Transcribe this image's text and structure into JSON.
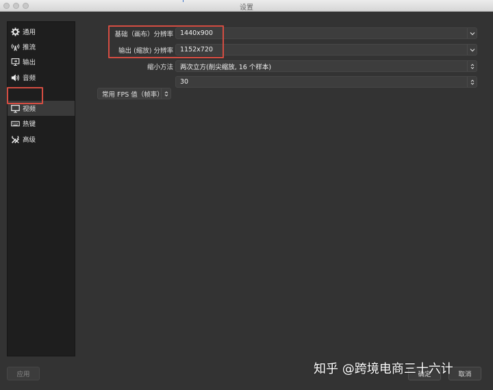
{
  "window": {
    "title": "设置"
  },
  "sidebar": {
    "items": [
      {
        "label": "通用",
        "icon": "gear-icon"
      },
      {
        "label": "推流",
        "icon": "broadcast-icon"
      },
      {
        "label": "输出",
        "icon": "output-icon"
      },
      {
        "label": "音频",
        "icon": "speaker-icon"
      },
      {
        "label": "视频",
        "icon": "monitor-icon",
        "active": true
      },
      {
        "label": "热键",
        "icon": "keyboard-icon"
      },
      {
        "label": "高级",
        "icon": "tools-icon"
      }
    ]
  },
  "video": {
    "base_resolution": {
      "label": "基础（画布）分辨率",
      "value": "1440x900"
    },
    "output_resolution": {
      "label": "输出 (缩放) 分辨率",
      "value": "1152x720"
    },
    "downscale_filter": {
      "label": "缩小方法",
      "value": "两次立方(削尖缩放, 16 个样本)"
    },
    "fps": {
      "label": "常用 FPS 值（帧率）",
      "value": "30"
    }
  },
  "buttons": {
    "apply": "应用",
    "ok": "确定",
    "cancel": "取消"
  },
  "watermark": "知乎 @跨境电商三十六计",
  "colors": {
    "highlight": "#d54d42",
    "background": "#333333",
    "sidebar": "#1e1e1e"
  }
}
